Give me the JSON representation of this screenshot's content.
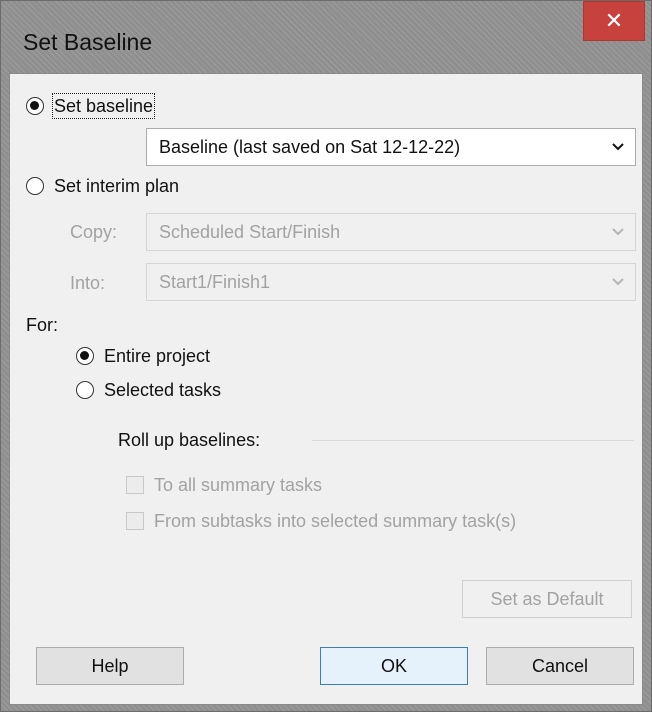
{
  "window": {
    "title": "Set Baseline",
    "close_symbol": "✕"
  },
  "set_baseline": {
    "label": "Set baseline",
    "selected": true,
    "dropdown_value": "Baseline (last saved on Sat 12-12-22)"
  },
  "interim_plan": {
    "label": "Set interim plan",
    "selected": false,
    "copy_label": "Copy:",
    "copy_value": "Scheduled Start/Finish",
    "into_label": "Into:",
    "into_value": "Start1/Finish1"
  },
  "for_section": {
    "label": "For:",
    "entire_project": {
      "label": "Entire project",
      "selected": true
    },
    "selected_tasks": {
      "label": "Selected tasks",
      "selected": false
    }
  },
  "rollup": {
    "label": "Roll up baselines:",
    "to_all_summary": {
      "label": "To all summary tasks",
      "checked": false,
      "enabled": false
    },
    "from_subtasks": {
      "label": "From subtasks into selected summary task(s)",
      "checked": false,
      "enabled": false
    }
  },
  "buttons": {
    "set_default": "Set as Default",
    "help": "Help",
    "ok": "OK",
    "cancel": "Cancel"
  }
}
